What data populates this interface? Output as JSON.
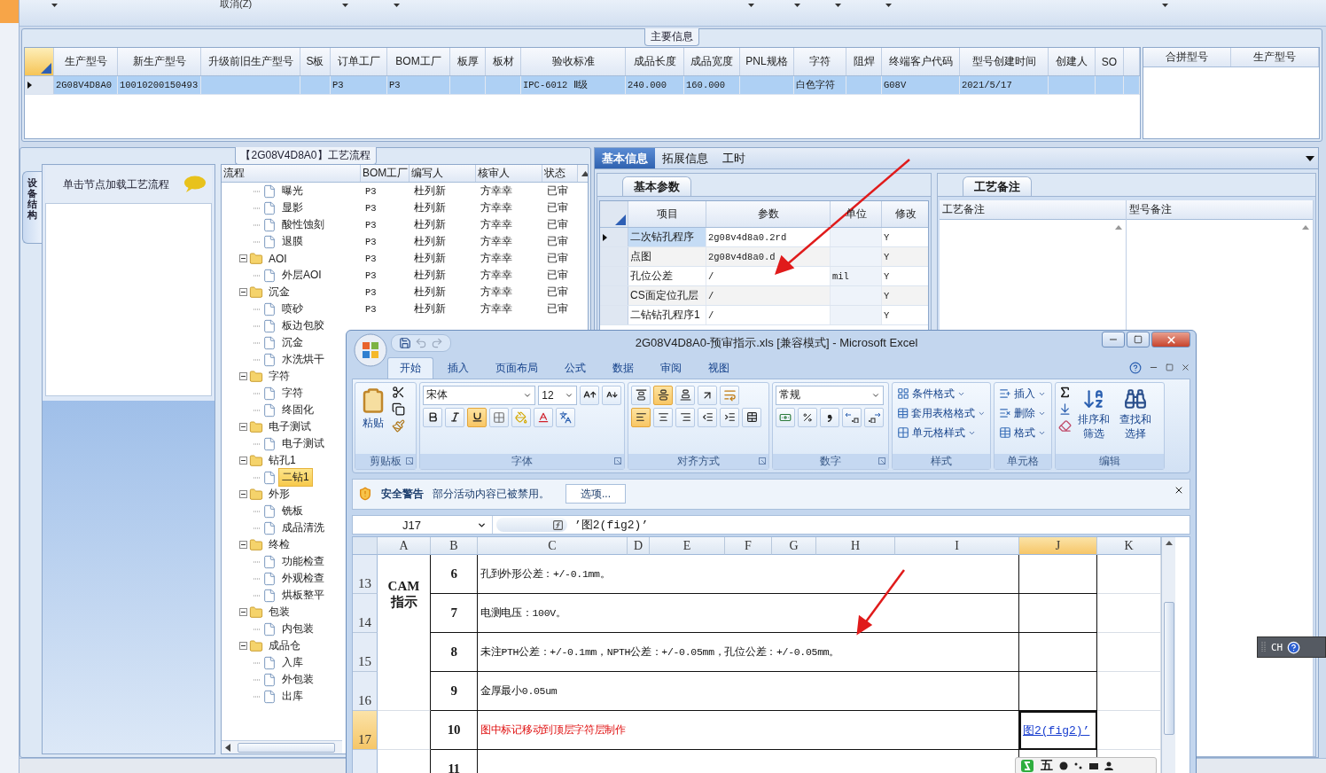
{
  "toolbar": {
    "cancel_label": "取消(Z)"
  },
  "main_info": {
    "title": "主要信息",
    "columns": [
      "生产型号",
      "新生产型号",
      "升级前旧生产型号",
      "S板",
      "订单工厂",
      "BOM工厂",
      "板厚",
      "板材",
      "验收标准",
      "成品长度",
      "成品宽度",
      "PNL规格",
      "字符",
      "阻焊",
      "终端客户代码",
      "型号创建时间",
      "创建人",
      "SO"
    ],
    "rows": [
      {
        "selected": true,
        "cells": [
          "2G08V4D8A0",
          "10010200150493",
          null,
          null,
          "P3",
          "P3",
          null,
          null,
          "IPC-6012 Ⅱ级",
          "240.000",
          "160.000",
          null,
          "白色字符",
          null,
          "G08V",
          "2021/5/17",
          null,
          null
        ]
      }
    ],
    "merge_columns": [
      "合拼型号",
      "生产型号"
    ]
  },
  "process": {
    "title": "【2G08V4D8A0】工艺流程",
    "side_tab": "设备结构",
    "hint": "单击节点加载工艺流程",
    "columns": [
      "流程",
      "BOM工厂",
      "编写人",
      "核审人",
      "状态"
    ],
    "tree": [
      {
        "kind": "offscreen",
        "children": [
          {
            "kind": "file",
            "label": "曝光",
            "selected": false,
            "cells": [
              "P3",
              "杜列新",
              "方幸幸",
              "已审"
            ]
          },
          {
            "kind": "file",
            "label": "显影",
            "selected": false,
            "cells": [
              "P3",
              "杜列新",
              "方幸幸",
              "已审"
            ]
          },
          {
            "kind": "file",
            "label": "酸性蚀刻",
            "selected": false,
            "cells": [
              "P3",
              "杜列新",
              "方幸幸",
              "已审"
            ]
          },
          {
            "kind": "file",
            "label": "退膜",
            "selected": false,
            "cells": [
              "P3",
              "杜列新",
              "方幸幸",
              "已审"
            ]
          }
        ]
      },
      {
        "kind": "folder",
        "label": "AOI",
        "expanded": true,
        "selected": false,
        "cells": [
          "P3",
          "杜列新",
          "方幸幸",
          "已审"
        ],
        "children": [
          {
            "kind": "file",
            "label": "外层AOI",
            "selected": false,
            "cells": [
              "P3",
              "杜列新",
              "方幸幸",
              "已审"
            ]
          }
        ]
      },
      {
        "kind": "folder",
        "label": "沉金",
        "expanded": true,
        "selected": false,
        "cells": [
          "P3",
          "杜列新",
          "方幸幸",
          "已审"
        ],
        "children": [
          {
            "kind": "file",
            "label": "喷砂",
            "selected": false,
            "cells": [
              "P3",
              "杜列新",
              "方幸幸",
              "已审"
            ]
          },
          {
            "kind": "file",
            "label": "板边包胶",
            "selected": false
          },
          {
            "kind": "file",
            "label": "沉金",
            "selected": false
          },
          {
            "kind": "file",
            "label": "水洗烘干",
            "selected": false
          }
        ]
      },
      {
        "kind": "folder",
        "label": "字符",
        "expanded": true,
        "selected": false,
        "children": [
          {
            "kind": "file",
            "label": "字符",
            "selected": false
          },
          {
            "kind": "file",
            "label": "终固化",
            "selected": false
          }
        ]
      },
      {
        "kind": "folder",
        "label": "电子测试",
        "expanded": true,
        "selected": false,
        "children": [
          {
            "kind": "file",
            "label": "电子测试",
            "selected": false
          }
        ]
      },
      {
        "kind": "folder",
        "label": "钻孔1",
        "expanded": true,
        "selected": false,
        "children": [
          {
            "kind": "file",
            "label": "二钻1",
            "selected": true
          }
        ]
      },
      {
        "kind": "folder",
        "label": "外形",
        "expanded": true,
        "selected": false,
        "children": [
          {
            "kind": "file",
            "label": "铣板",
            "selected": false
          },
          {
            "kind": "file",
            "label": "成品清洗",
            "selected": false
          }
        ]
      },
      {
        "kind": "folder",
        "label": "终检",
        "expanded": true,
        "selected": false,
        "children": [
          {
            "kind": "file",
            "label": "功能检查",
            "selected": false
          },
          {
            "kind": "file",
            "label": "外观检查",
            "selected": false
          },
          {
            "kind": "file",
            "label": "烘板整平",
            "selected": false
          }
        ]
      },
      {
        "kind": "folder",
        "label": "包装",
        "expanded": true,
        "selected": false,
        "children": [
          {
            "kind": "file",
            "label": "内包装",
            "selected": false
          }
        ]
      },
      {
        "kind": "folder",
        "label": "成品仓",
        "expanded": true,
        "selected": false,
        "children": [
          {
            "kind": "file",
            "label": "入库",
            "selected": false
          },
          {
            "kind": "file",
            "label": "外包装",
            "selected": false
          },
          {
            "kind": "file",
            "label": "出库",
            "selected": false
          }
        ]
      }
    ]
  },
  "details": {
    "tabs": [
      {
        "label": "基本信息",
        "selected": true
      },
      {
        "label": "拓展信息",
        "selected": false
      },
      {
        "label": "工时",
        "selected": false
      }
    ],
    "params": {
      "tab": "基本参数",
      "columns": [
        "项目",
        "参数",
        "单位",
        "修改"
      ],
      "rows": [
        {
          "selected": true,
          "cells": [
            "二次钻孔程序",
            "2g08v4d8a0.2rd",
            null,
            "Y"
          ]
        },
        {
          "selected": false,
          "cells": [
            "点图",
            "2g08v4d8a0.d",
            null,
            "Y"
          ]
        },
        {
          "selected": false,
          "cells": [
            "孔位公差",
            "/",
            "mil",
            "Y"
          ]
        },
        {
          "selected": false,
          "cells": [
            "CS面定位孔层",
            "/",
            null,
            "Y"
          ]
        },
        {
          "selected": false,
          "cells": [
            "二钻钻孔程序1",
            "/",
            null,
            "Y"
          ]
        }
      ]
    },
    "remarks": {
      "tab": "工艺备注",
      "columns": [
        "工艺备注",
        "型号备注"
      ]
    }
  },
  "excel": {
    "title": "2G08V4D8A0-预审指示.xls  [兼容模式] - Microsoft Excel",
    "tabs": [
      {
        "label": "开始",
        "selected": true
      },
      {
        "label": "插入",
        "selected": false
      },
      {
        "label": "页面布局",
        "selected": false
      },
      {
        "label": "公式",
        "selected": false
      },
      {
        "label": "数据",
        "selected": false
      },
      {
        "label": "审阅",
        "selected": false
      },
      {
        "label": "视图",
        "selected": false
      }
    ],
    "ribbon": {
      "paste": "粘贴",
      "font_name": "宋体",
      "font_size": "12",
      "number_format": "常规",
      "font_buttons": [
        {
          "kind": "bold",
          "on": false
        },
        {
          "kind": "italic",
          "on": false
        },
        {
          "kind": "underline",
          "on": true
        }
      ],
      "valign_buttons": [
        {
          "kind": "top",
          "on": false
        },
        {
          "kind": "middle",
          "on": true
        },
        {
          "kind": "bottom",
          "on": false
        }
      ],
      "halign_buttons": [
        {
          "kind": "left",
          "on": true
        },
        {
          "kind": "center",
          "on": false
        },
        {
          "kind": "right",
          "on": false
        }
      ],
      "styles": [
        "条件格式",
        "套用表格格式",
        "单元格样式"
      ],
      "cells": [
        "插入",
        "删除",
        "格式"
      ],
      "sort": "排序和筛选",
      "find": "查找和选择",
      "groups": [
        "剪贴板",
        "字体",
        "对齐方式",
        "数字",
        "样式",
        "单元格",
        "编辑"
      ]
    },
    "security": {
      "title": "安全警告",
      "message": "部分活动内容已被禁用。",
      "button": "选项..."
    },
    "formula": {
      "cell": "J17",
      "value": "’图2(fig2)’"
    },
    "columns": [
      {
        "label": "A",
        "selected": false
      },
      {
        "label": "B",
        "selected": false
      },
      {
        "label": "C",
        "selected": false
      },
      {
        "label": "D",
        "selected": false
      },
      {
        "label": "E",
        "selected": false
      },
      {
        "label": "F",
        "selected": false
      },
      {
        "label": "G",
        "selected": false
      },
      {
        "label": "H",
        "selected": false
      },
      {
        "label": "I",
        "selected": false
      },
      {
        "label": "J",
        "selected": true
      },
      {
        "label": "K",
        "selected": false
      }
    ],
    "merged_label": "CAM 指示",
    "rows": [
      {
        "number": "13",
        "selected": false,
        "item": "6",
        "text": "孔到外形公差：+/-0.1mm。",
        "kind": "plain"
      },
      {
        "number": "14",
        "selected": false,
        "item": "7",
        "text": "电测电压：100V。",
        "kind": "plain"
      },
      {
        "number": "15",
        "selected": false,
        "item": "8",
        "text": "未注PTH公差：+/-0.1mm，NPTH公差：+/-0.05mm，孔位公差：+/-0.05mm。",
        "kind": "plain"
      },
      {
        "number": "16",
        "selected": false,
        "item": "9",
        "text": "金厚最小0.05um",
        "kind": "plain"
      },
      {
        "number": "17",
        "selected": true,
        "item": "10",
        "text": "图中标记移动到顶层字符层制作",
        "kind": "alert",
        "link": "图2(fig2)’"
      },
      {
        "selected": false,
        "item": "11"
      }
    ]
  },
  "ime_bar": {
    "label": "CH"
  },
  "input_bar": {
    "label": "五"
  }
}
